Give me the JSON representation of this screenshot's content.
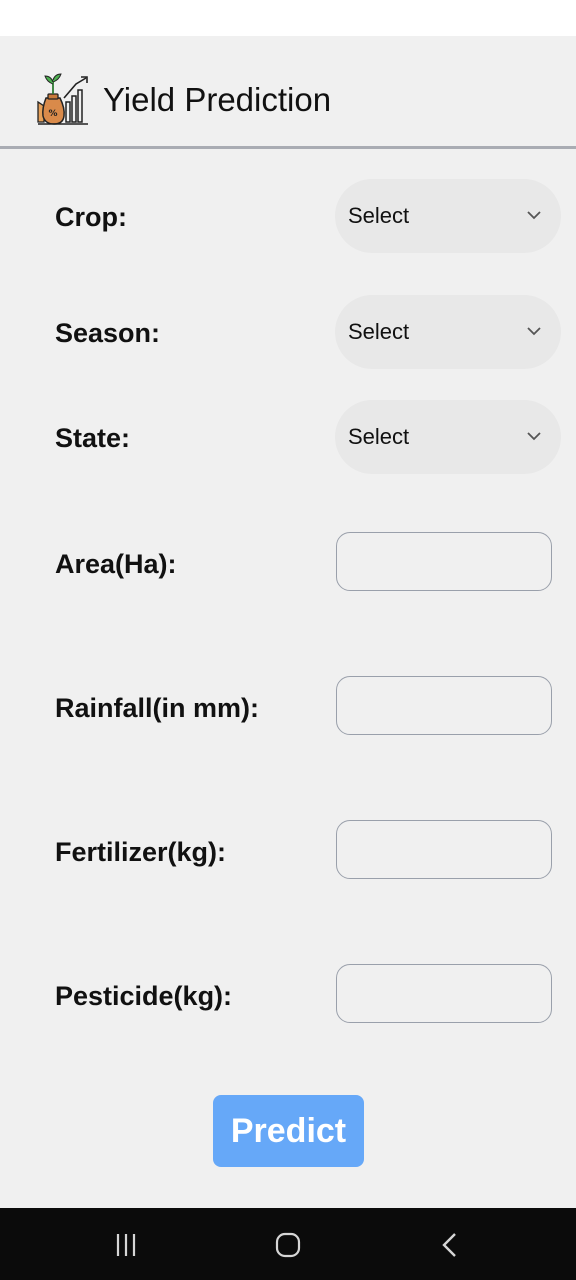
{
  "header": {
    "title": "Yield Prediction",
    "logo_icon": "crop-yield-growth-icon"
  },
  "form": {
    "crop": {
      "label": "Crop:",
      "value": "Select"
    },
    "season": {
      "label": "Season:",
      "value": "Select"
    },
    "state": {
      "label": "State:",
      "value": "Select"
    },
    "area": {
      "label": "Area(Ha):",
      "value": ""
    },
    "rainfall": {
      "label": "Rainfall(in mm):",
      "value": ""
    },
    "fertilizer": {
      "label": "Fertilizer(kg):",
      "value": ""
    },
    "pesticide": {
      "label": "Pesticide(kg):",
      "value": ""
    }
  },
  "predict_button": {
    "label": "Predict"
  },
  "nav": {
    "recents_icon": "recent-apps-icon",
    "home_icon": "home-icon",
    "back_icon": "back-icon"
  },
  "colors": {
    "background": "#f0f0f0",
    "select_fill": "#e8e8e8",
    "input_border": "#9aa0ab",
    "button": "#66a8f8",
    "nav_bar": "#0b0b0b"
  }
}
